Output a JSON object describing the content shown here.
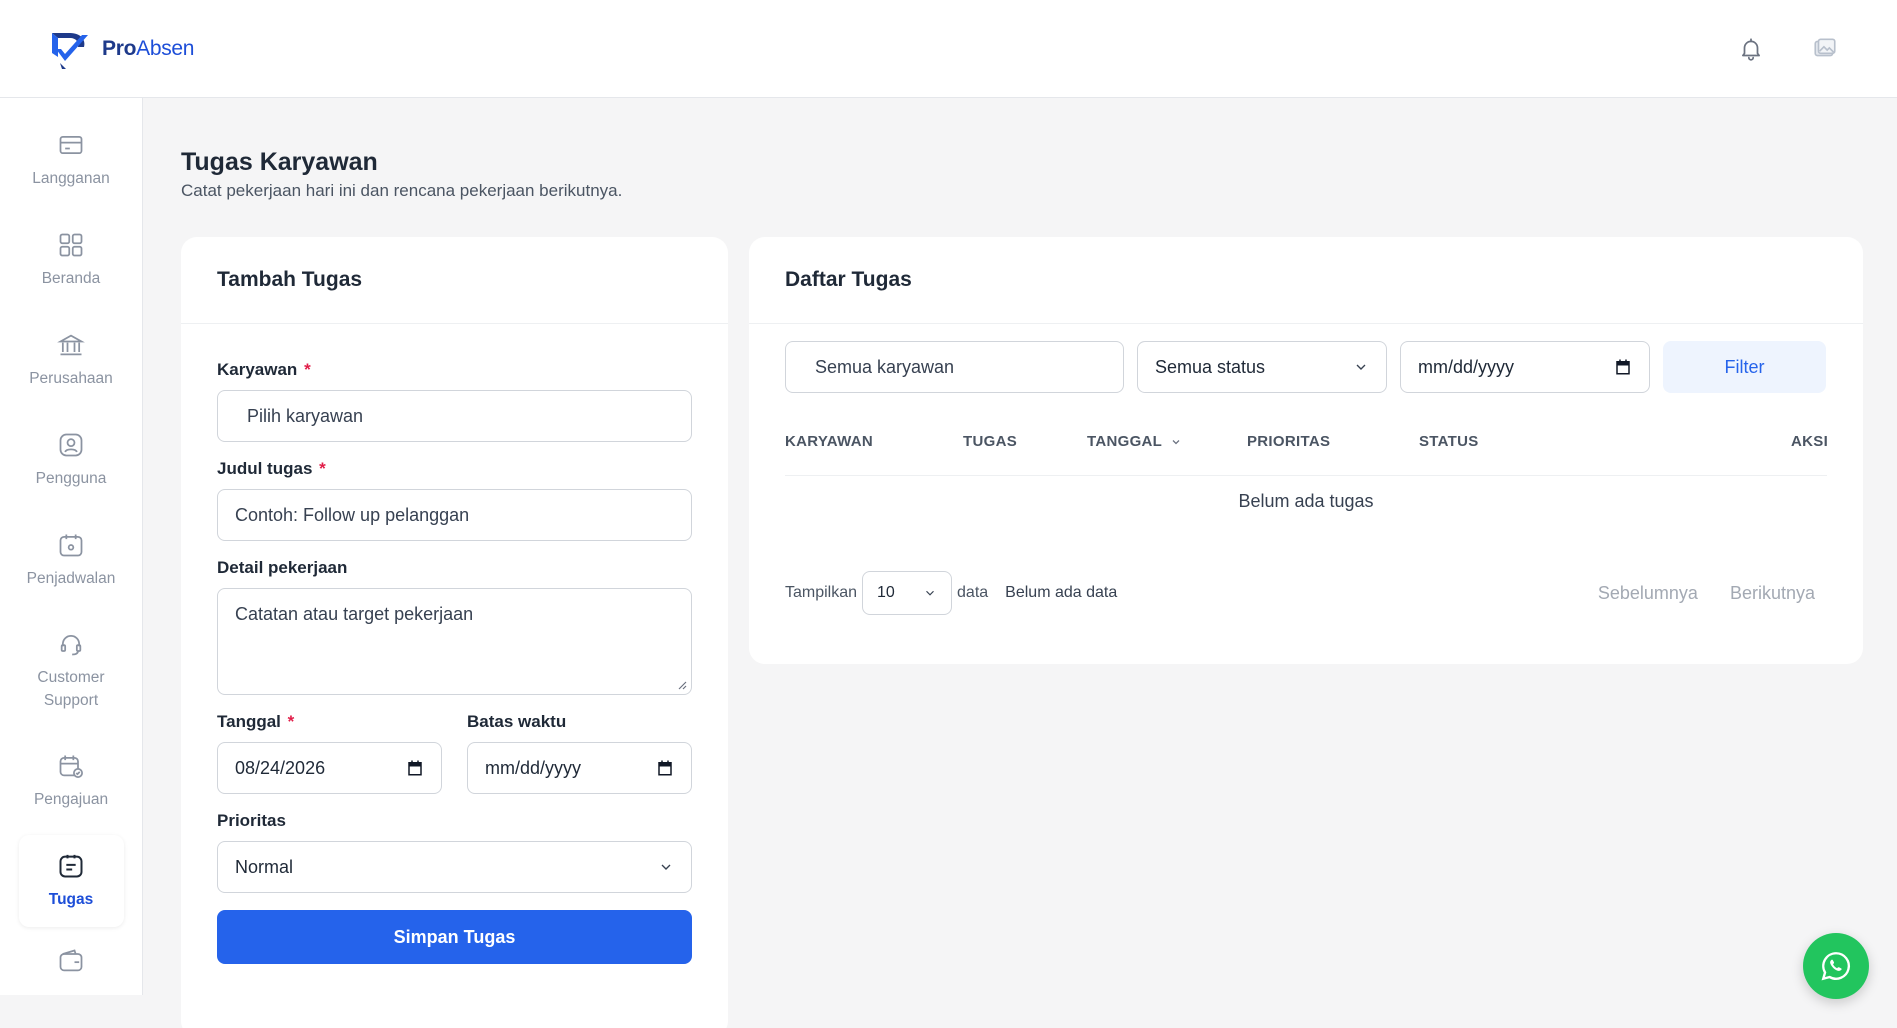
{
  "app": {
    "brand_bold": "Pro",
    "brand_light": "Absen"
  },
  "header": {
    "icons": [
      "bell-icon",
      "image-icon"
    ]
  },
  "sidebar": {
    "items": [
      {
        "label": "Langganan",
        "icon": "credit-card-icon"
      },
      {
        "label": "Beranda",
        "icon": "grid-icon"
      },
      {
        "label": "Perusahaan",
        "icon": "bank-icon"
      },
      {
        "label": "Pengguna",
        "icon": "user-icon"
      },
      {
        "label": "Penjadwalan",
        "icon": "calendar-icon"
      },
      {
        "label": "Customer Support",
        "icon": "headset-icon"
      },
      {
        "label": "Pengajuan",
        "icon": "calendar-check-icon"
      },
      {
        "label": "Tugas",
        "icon": "task-icon",
        "active": true
      },
      {
        "label": "",
        "icon": "wallet-icon"
      }
    ]
  },
  "page": {
    "title": "Tugas Karyawan",
    "subtitle": "Catat pekerjaan hari ini dan rencana pekerjaan berikutnya."
  },
  "form": {
    "title": "Tambah Tugas",
    "employee_label": "Karyawan",
    "employee_placeholder": "Pilih karyawan",
    "task_title_label": "Judul tugas",
    "task_title_placeholder": "Contoh: Follow up pelanggan",
    "detail_label": "Detail pekerjaan",
    "detail_placeholder": "Catatan atau target pekerjaan",
    "date_label": "Tanggal",
    "date_value": "08/24/2026",
    "deadline_label": "Batas waktu",
    "deadline_value": "mm/dd/yyyy",
    "priority_label": "Prioritas",
    "priority_value": "Normal",
    "required_mark": "*",
    "submit_label": "Simpan Tugas"
  },
  "list": {
    "title": "Daftar Tugas",
    "filter_employee": "Semua karyawan",
    "filter_status": "Semua status",
    "filter_date": "mm/dd/yyyy",
    "filter_button": "Filter",
    "columns": [
      "KARYAWAN",
      "TUGAS",
      "TANGGAL",
      "PRIORITAS",
      "STATUS",
      "AKSI"
    ],
    "empty_text": "Belum ada tugas",
    "pager": {
      "show_label": "Tampilkan",
      "page_size": "10",
      "data_label": "data",
      "info": "Belum ada data",
      "prev": "Sebelumnya",
      "next": "Berikutnya"
    }
  },
  "colors": {
    "primary": "#2563eb",
    "brand": "#1e3a8a",
    "whatsapp": "#22c55e",
    "required": "#e11d48"
  }
}
